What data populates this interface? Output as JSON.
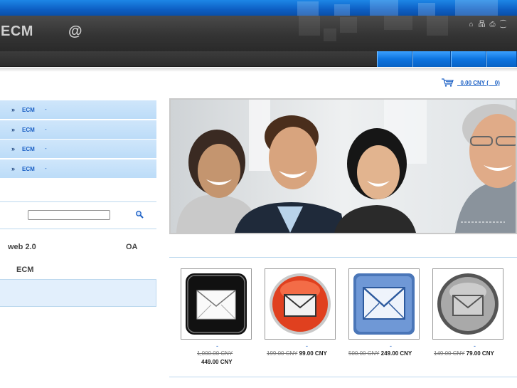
{
  "header": {
    "title": "ECM",
    "at_symbol": "@",
    "icons": [
      "home-icon",
      "sitemap-icon",
      "print-icon",
      "rss-icon"
    ],
    "icon_glyphs": [
      "⌂",
      "品",
      "⎙",
      "⁐"
    ]
  },
  "nav": {
    "tabs": [
      {
        "label": ""
      },
      {
        "label": ""
      },
      {
        "label": ""
      },
      {
        "label": ""
      }
    ],
    "colors": {
      "tab": "#0d74e0",
      "bar": "#333333"
    }
  },
  "cart": {
    "text": "  0.00 CNY (    0)"
  },
  "menu": {
    "items": [
      {
        "arrows": "»",
        "label": "ECM",
        "dash": "-"
      },
      {
        "arrows": "»",
        "label": "ECM",
        "dash": "-"
      },
      {
        "arrows": "»",
        "label": "ECM",
        "dash": "-"
      },
      {
        "arrows": "»",
        "label": "ECM",
        "dash": "-"
      }
    ]
  },
  "search": {
    "placeholder": ""
  },
  "links": {
    "web": "web 2.0",
    "oa": "OA",
    "ecm": "ECM"
  },
  "products": [
    {
      "name": "-",
      "old_price": "1,000.00 CNY",
      "new_price": "449.00 CNY",
      "icon": "mail-black-icon"
    },
    {
      "name": "-",
      "old_price": "199.00 CNY",
      "new_price": "99.00 CNY",
      "icon": "mail-red-icon"
    },
    {
      "name": "-",
      "old_price": "500.00 CNY",
      "new_price": "249.00 CNY",
      "icon": "mail-blue-icon"
    },
    {
      "name": "-",
      "old_price": "149.00 CNY",
      "new_price": "79.00 CNY",
      "icon": "mail-silver-icon"
    }
  ],
  "colors": {
    "brand_blue": "#0d74e0",
    "menu_bg": "#cfe6fb",
    "link": "#1a5fc4"
  }
}
